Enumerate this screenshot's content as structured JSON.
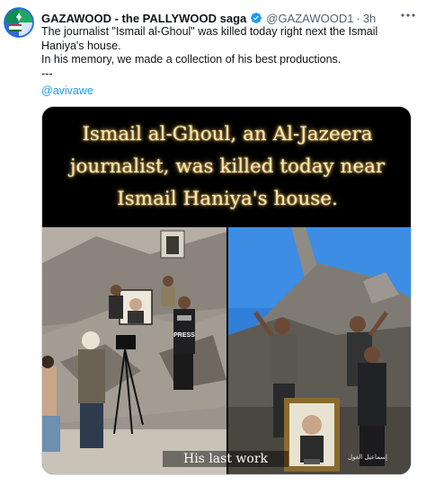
{
  "tweet": {
    "author_name": "GAZAWOOD - the PALLYWOOD saga",
    "handle": "@GAZAWOOD1",
    "separator": "·",
    "time": "3h",
    "text_lines": [
      "The journalist \"Ismail al-Ghoul\" was killed today right next  the Ismail",
      "Haniya's house.",
      "In his memory, we made a collection of his best productions.",
      "---"
    ],
    "mention": "@avivawe"
  },
  "media": {
    "caption_lines": [
      "Ismail al-Ghoul, an Al-Jazeera",
      "journalist, was killed today near",
      "Ismail Haniya's house."
    ],
    "subtitle": "His last work",
    "vest_text": "PRESS",
    "watermark": "إسماعيل الغول"
  },
  "colors": {
    "accent": "#1d9bf0",
    "caption_text": "#f8e7b0",
    "secondary_text": "#536471"
  },
  "icons": [
    "avatar-logo",
    "verified-badge-icon",
    "more-options-icon"
  ]
}
